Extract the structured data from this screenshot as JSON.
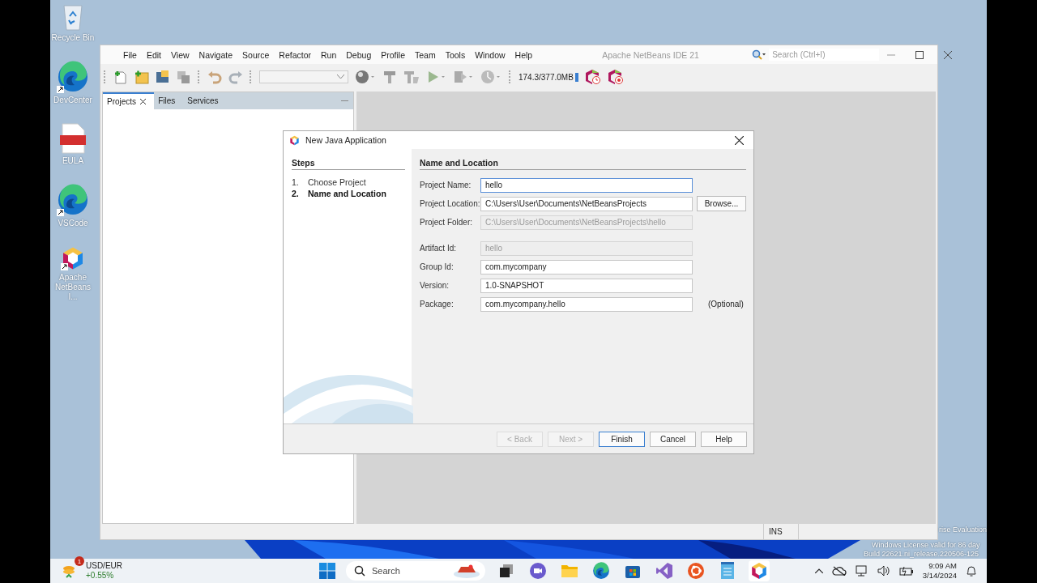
{
  "desktop_icons": [
    {
      "label": "Recycle Bin",
      "kind": "bin",
      "shortcut": false
    },
    {
      "label": "DevCenter",
      "kind": "edge",
      "shortcut": true
    },
    {
      "label": "EULA",
      "kind": "pdf",
      "shortcut": false
    },
    {
      "label": "VSCode",
      "kind": "edge",
      "shortcut": true
    },
    {
      "label": "Apache NetBeans I...",
      "kind": "netbeans",
      "shortcut": true
    }
  ],
  "ide": {
    "title": "Apache NetBeans IDE 21",
    "menu": [
      "File",
      "Edit",
      "View",
      "Navigate",
      "Source",
      "Refactor",
      "Run",
      "Debug",
      "Profile",
      "Team",
      "Tools",
      "Window",
      "Help"
    ],
    "search": {
      "placeholder": "Search (Ctrl+I)"
    },
    "memory": "174.3/377.0MB",
    "panel_tabs": [
      {
        "label": "Projects",
        "selected": true
      },
      {
        "label": "Files",
        "selected": false
      },
      {
        "label": "Services",
        "selected": false
      }
    ],
    "status_bar": {
      "mode": "INS"
    }
  },
  "dialog": {
    "title": "New Java Application",
    "steps_heading": "Steps",
    "steps": [
      {
        "number": "1.",
        "label": "Choose Project",
        "selected": false
      },
      {
        "number": "2.",
        "label": "Name and Location",
        "selected": true
      }
    ],
    "section_title": "Name and Location",
    "field_groups": [
      [
        {
          "label": "Project Name:",
          "value": "hello",
          "disabled": false,
          "focused": true
        },
        {
          "label": "Project Location:",
          "value": "C:\\Users\\User\\Documents\\NetBeansProjects",
          "disabled": false,
          "focused": false,
          "button": "Browse..."
        },
        {
          "label": "Project Folder:",
          "value": "C:\\Users\\User\\Documents\\NetBeansProjects\\hello",
          "disabled": true,
          "focused": false
        }
      ],
      [
        {
          "label": "Artifact Id:",
          "value": "hello",
          "disabled": true,
          "focused": false
        },
        {
          "label": "Group Id:",
          "value": "com.mycompany",
          "disabled": false,
          "focused": false
        },
        {
          "label": "Version:",
          "value": "1.0-SNAPSHOT",
          "disabled": false,
          "focused": false
        },
        {
          "label": "Package:",
          "value": "com.mycompany.hello",
          "disabled": false,
          "focused": false,
          "note": "(Optional)"
        }
      ]
    ],
    "buttons": [
      {
        "label": "< Back",
        "disabled": true,
        "default": false
      },
      {
        "label": "Next >",
        "disabled": true,
        "default": false
      },
      {
        "label": "Finish",
        "disabled": false,
        "default": true
      },
      {
        "label": "Cancel",
        "disabled": false,
        "default": false
      },
      {
        "label": "Help",
        "disabled": false,
        "default": false
      }
    ]
  },
  "os_watermark": [
    "rise Evaluation",
    "Windows License valid for 86 day",
    "Build 22621.ni_release.220506-125"
  ],
  "taskbar": {
    "widget": {
      "badge": "1",
      "title": "USD/EUR",
      "change": "+0.55%"
    },
    "search": {
      "placeholder": "Search"
    },
    "apps": [
      {
        "kind": "taskview",
        "selected": false
      },
      {
        "kind": "chat",
        "selected": false
      },
      {
        "kind": "folder",
        "selected": false
      },
      {
        "kind": "edge",
        "selected": false
      },
      {
        "kind": "store",
        "selected": false
      },
      {
        "kind": "vs",
        "selected": false
      },
      {
        "kind": "ubuntu",
        "selected": false
      },
      {
        "kind": "notepad",
        "selected": false
      },
      {
        "kind": "netbeans",
        "selected": true
      }
    ],
    "time": "9:09 AM",
    "date": "3/14/2024"
  }
}
